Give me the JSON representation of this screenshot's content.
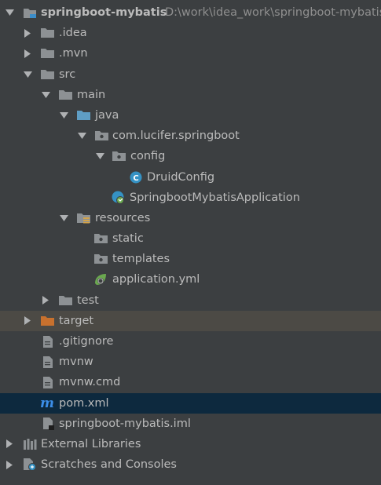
{
  "colors": {
    "background": "#3c3f41",
    "text": "#bbbbbb",
    "path_text": "#8f8f8f",
    "folder": "#8d9194",
    "folder_source": "#5f9ec5",
    "folder_excluded": "#c8712e",
    "class_icon": "#3592c4",
    "spring": "#6aa84f",
    "maven": "#3c8ee8",
    "inactive_selection": "#4c4a45",
    "active_selection": "#0d293e"
  },
  "tree": [
    {
      "label": "springboot-mybatis",
      "path": "D:\\work\\idea_work\\springboot-mybatis",
      "icon": "module-folder-icon",
      "arrow": "expanded"
    },
    {
      "label": ".idea",
      "icon": "folder-icon",
      "arrow": "collapsed"
    },
    {
      "label": ".mvn",
      "icon": "folder-icon",
      "arrow": "collapsed"
    },
    {
      "label": "src",
      "icon": "folder-icon",
      "arrow": "expanded"
    },
    {
      "label": "main",
      "icon": "folder-icon",
      "arrow": "expanded"
    },
    {
      "label": "java",
      "icon": "source-folder-icon",
      "arrow": "expanded"
    },
    {
      "label": "com.lucifer.springboot",
      "icon": "package-icon",
      "arrow": "expanded"
    },
    {
      "label": "config",
      "icon": "package-icon",
      "arrow": "expanded"
    },
    {
      "label": "DruidConfig",
      "icon": "class-icon"
    },
    {
      "label": "SpringbootMybatisApplication",
      "icon": "spring-boot-class-icon"
    },
    {
      "label": "resources",
      "icon": "resources-folder-icon",
      "arrow": "expanded"
    },
    {
      "label": "static",
      "icon": "folder-icon"
    },
    {
      "label": "templates",
      "icon": "folder-icon"
    },
    {
      "label": "application.yml",
      "icon": "spring-config-icon"
    },
    {
      "label": "test",
      "icon": "folder-icon",
      "arrow": "collapsed"
    },
    {
      "label": "target",
      "icon": "excluded-folder-icon",
      "arrow": "collapsed"
    },
    {
      "label": ".gitignore",
      "icon": "text-file-icon"
    },
    {
      "label": "mvnw",
      "icon": "text-file-icon"
    },
    {
      "label": "mvnw.cmd",
      "icon": "text-file-icon"
    },
    {
      "label": "pom.xml",
      "icon": "maven-icon"
    },
    {
      "label": "springboot-mybatis.iml",
      "icon": "iml-file-icon"
    },
    {
      "label": "External Libraries",
      "icon": "libraries-icon",
      "arrow": "collapsed"
    },
    {
      "label": "Scratches and Consoles",
      "icon": "scratches-icon",
      "arrow": "collapsed"
    }
  ]
}
